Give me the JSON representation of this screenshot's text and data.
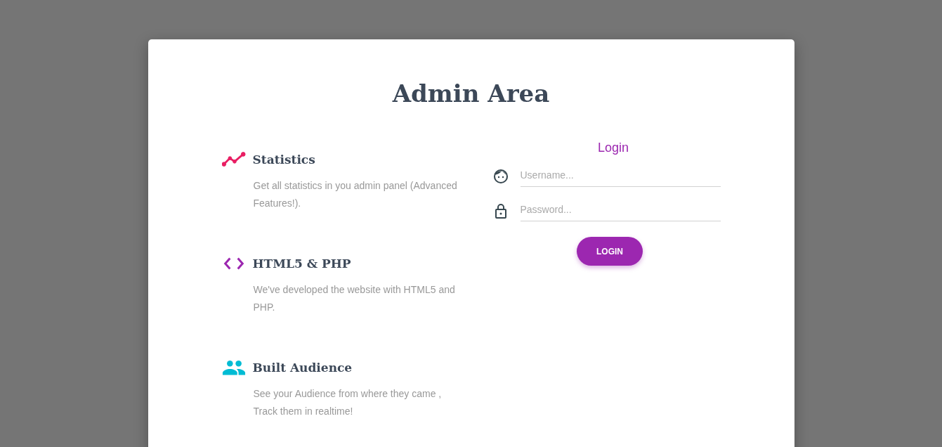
{
  "title": "Admin Area",
  "features": [
    {
      "kind": "chart",
      "color": "#e91e63",
      "heading": "Statistics",
      "text": "Get all statistics in you admin panel (Advanced Features!)."
    },
    {
      "kind": "code",
      "color": "#9c27b0",
      "heading": "HTML5 & PHP",
      "text": "We've developed the website with HTML5 and PHP."
    },
    {
      "kind": "people",
      "color": "#00bcd4",
      "heading": "Built Audience",
      "text": "See your Audience from where they came , Track them in realtime!"
    }
  ],
  "login": {
    "title": "Login",
    "fields": [
      {
        "kind": "user",
        "placeholder": "Username..."
      },
      {
        "kind": "password",
        "placeholder": "Password..."
      }
    ],
    "button": "LOGIN"
  }
}
